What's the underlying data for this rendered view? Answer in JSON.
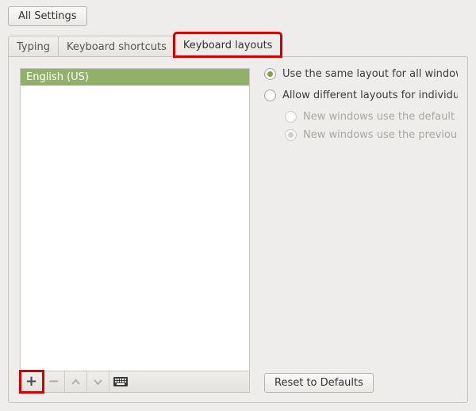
{
  "topbar": {
    "all_settings_label": "All Settings"
  },
  "tabs": {
    "typing": "Typing",
    "shortcuts": "Keyboard shortcuts",
    "layouts": "Keyboard layouts"
  },
  "layouts": {
    "items": [
      "English (US)"
    ]
  },
  "toolbar_icons": {
    "add": "+",
    "remove": "−",
    "up": "˄",
    "down": "˅",
    "keyboard": "keyboard"
  },
  "options": {
    "same_layout": "Use the same layout for all windows",
    "diff_layout": "Allow different layouts for individual windows",
    "new_default": "New windows use the default layout",
    "new_previous": "New windows use the previous window's layout"
  },
  "buttons": {
    "reset": "Reset to Defaults"
  }
}
